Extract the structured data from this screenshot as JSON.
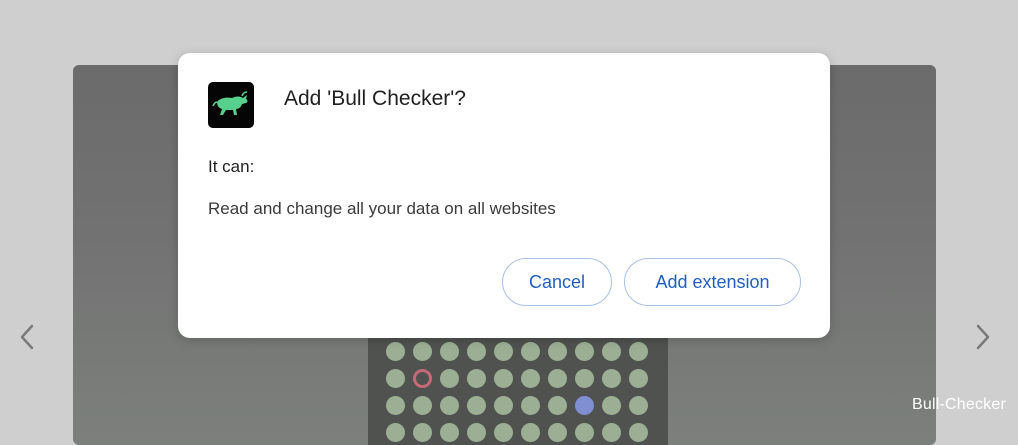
{
  "dialog": {
    "title": "Add 'Bull Checker'?",
    "permissions_heading": "It can:",
    "permissions": [
      "Read and change all your data on all websites"
    ],
    "cancel_label": "Cancel",
    "add_label": "Add extension"
  },
  "watermark": "Bull-Checker",
  "colors": {
    "accent": "#1f5fbf",
    "logo_bull": "#58d08d",
    "logo_bg": "#050505"
  },
  "icons": {
    "logo": "bull-icon",
    "prev": "chevron-left-icon",
    "next": "chevron-right-icon"
  }
}
